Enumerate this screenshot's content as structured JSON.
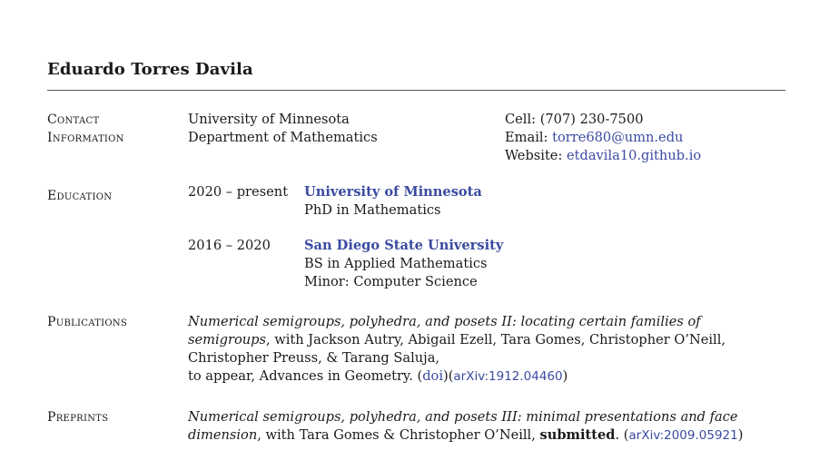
{
  "header": {
    "name": "Eduardo Torres Davila"
  },
  "contact": {
    "label_line1": "Contact",
    "label_line2": "Information",
    "address_line1": "University of Minnesota",
    "address_line2": "Department of Mathematics",
    "cell_label": "Cell:",
    "cell_value": "(707) 230-7500",
    "email_label": "Email:",
    "email_value": "torre680@umn.edu",
    "website_label": "Website:",
    "website_value": "etdavila10.github.io"
  },
  "education": {
    "label": "Education",
    "entries": [
      {
        "dates": "2020 – present",
        "institution": "University of Minnesota",
        "details": [
          "PhD in Mathematics"
        ]
      },
      {
        "dates": "2016 – 2020",
        "institution": "San Diego State University",
        "details": [
          "BS in Applied Mathematics",
          "Minor: Computer Science"
        ]
      }
    ]
  },
  "publications": {
    "label": "Publications",
    "items": [
      {
        "title": "Numerical semigroups, polyhedra, and posets II: locating certain families of semigroups",
        "authors_line": "with Jackson Autry, Abigail Ezell, Tara Gomes, Christopher O’Neill, Christopher Preuss, & Tarang Saluja,",
        "venue": "to appear, Advances in Geometry.",
        "doi": "doi",
        "arxiv": "arXiv:1912.04460"
      }
    ]
  },
  "preprints": {
    "label": "Preprints",
    "items": [
      {
        "title": "Numerical semigroups, polyhedra, and posets III: minimal presentations and face dimension",
        "authors_line": "with Tara Gomes & Christopher O’Neill,",
        "status": "submitted",
        "arxiv": "arXiv:2009.05921"
      }
    ]
  },
  "colors": {
    "link": "#3b4ba0",
    "text": "#1a1a1a",
    "rule": "#555555"
  }
}
